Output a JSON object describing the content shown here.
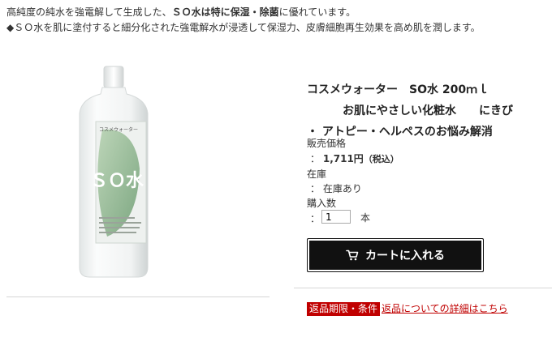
{
  "intro": {
    "line1_start": "高純度の純水を強電解して生成した、",
    "line1_bold": "ＳＯ水は特に保湿・除菌",
    "line1_end": "に優れています。",
    "line2": "◆ＳＯ水を肌に塗付すると細分化された強電解水が浸透して保湿力、皮膚細胞再生効果を高め肌を潤します。"
  },
  "product": {
    "image_label": "コスメウォーター",
    "image_mark": "ＳＯ水",
    "title_line1": "コスメウォーター　SO水 200ｍｌ",
    "title_line2": "お肌にやさしい化粧水　　にきび",
    "title_line3": "・ アトピー・ヘルペスのお悩み解消"
  },
  "price": {
    "label": "販売価格",
    "prefix": "：",
    "value": "1,711円",
    "tax": "（税込）"
  },
  "stock": {
    "label": "在庫",
    "value": "：  在庫あり"
  },
  "quantity": {
    "label": "購入数",
    "prefix": "：",
    "value": "1",
    "unit": "本"
  },
  "cart": {
    "button_label": "カートに入れる"
  },
  "returns": {
    "badge": "返品期限・条件",
    "link": "返品についての詳細はこちら"
  },
  "colors": {
    "accent_red": "#c00000",
    "button_bg": "#111111"
  }
}
